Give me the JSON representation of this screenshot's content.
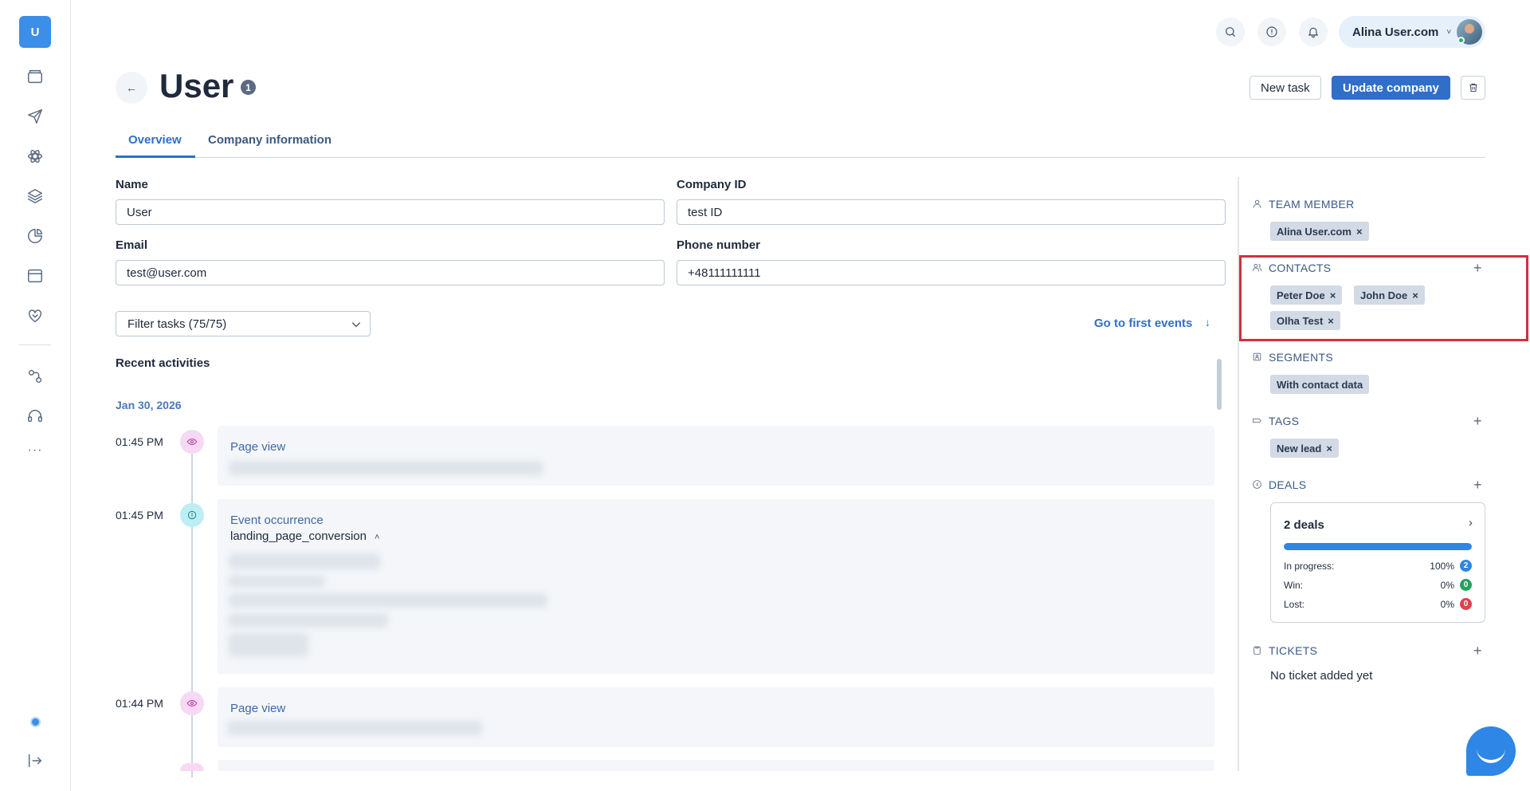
{
  "sidebar": {
    "logo_letter": "U",
    "more": "···"
  },
  "topbar": {
    "user_name": "Alina User.com",
    "user_chevron": "˅"
  },
  "header": {
    "back_arrow": "←",
    "title": "User",
    "title_badge": "1",
    "new_task_label": "New task",
    "update_company_label": "Update company"
  },
  "tabs": [
    {
      "label": "Overview"
    },
    {
      "label": "Company information"
    }
  ],
  "form": {
    "name_label": "Name",
    "name_value": "User",
    "company_id_label": "Company ID",
    "company_id_value": "test ID",
    "email_label": "Email",
    "email_value": "test@user.com",
    "phone_label": "Phone number",
    "phone_value": "+48111111111"
  },
  "activities": {
    "filter_label": "Filter tasks (75/75)",
    "go_first_label": "Go to first events",
    "go_first_arrow": "↓",
    "heading": "Recent activities",
    "date": "Jan 30, 2026",
    "items": [
      {
        "time": "01:45 PM",
        "title": "Page view",
        "icon": "eye-icon"
      },
      {
        "time": "01:45 PM",
        "title": "Event occurrence",
        "subtitle": "landing_page_conversion",
        "caret": "˄",
        "icon": "info-icon"
      },
      {
        "time": "01:44 PM",
        "title": "Page view",
        "icon": "eye-icon"
      }
    ]
  },
  "right_panel": {
    "team_member": {
      "heading": "TEAM MEMBER",
      "chips": [
        "Alina User.com"
      ]
    },
    "contacts": {
      "heading": "CONTACTS",
      "chips": [
        "Peter Doe",
        "John Doe",
        "Olha Test"
      ]
    },
    "segments": {
      "heading": "SEGMENTS",
      "chips": [
        "With contact data"
      ]
    },
    "tags": {
      "heading": "TAGS",
      "chips": [
        "New lead"
      ]
    },
    "deals": {
      "heading": "DEALS",
      "count": "2 deals",
      "chevron": "›",
      "progress_fraction": 1.0,
      "rows": [
        {
          "label": "In progress:",
          "pct": "100%",
          "count": "2",
          "color": "#2e86e6"
        },
        {
          "label": "Win:",
          "pct": "0%",
          "count": "0",
          "color": "#23a35e"
        },
        {
          "label": "Lost:",
          "pct": "0%",
          "count": "0",
          "color": "#e0414d"
        }
      ]
    },
    "tickets": {
      "heading": "TICKETS",
      "empty": "No ticket added yet"
    },
    "plus": "+",
    "remove": "×"
  },
  "colors": {
    "accent": "#2f6fc9",
    "highlight": "#d0303b"
  }
}
